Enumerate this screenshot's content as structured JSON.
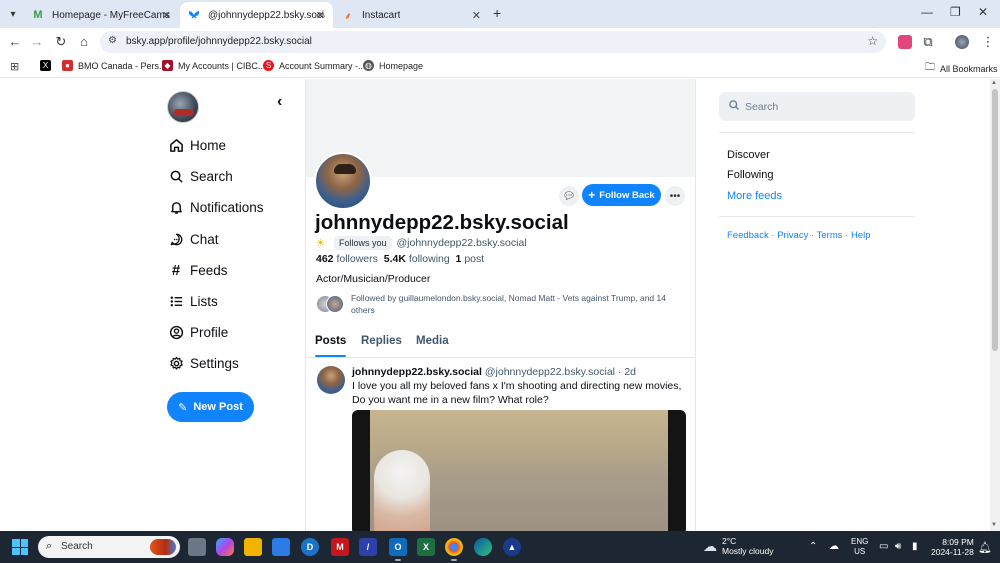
{
  "browser": {
    "tabs": [
      {
        "title": "Homepage - MyFreeCams",
        "favicon": "M",
        "favicon_color": "#2f9e44",
        "active": false
      },
      {
        "title": "@johnnydepp22.bsky.social —",
        "favicon": "butterfly",
        "favicon_color": "#1083fe",
        "active": true
      },
      {
        "title": "Instacart",
        "favicon": "carrot",
        "favicon_color": "#2f9e44",
        "active": false
      }
    ],
    "url": "bsky.app/profile/johnnydepp22.bsky.social",
    "bookmarks": [
      {
        "label": "",
        "icon": "x-icon",
        "color": "#000000"
      },
      {
        "label": "BMO Canada - Pers...",
        "icon": "bmo-icon",
        "color": "#d22e2e"
      },
      {
        "label": "My Accounts | CIBC...",
        "icon": "cibc-icon",
        "color": "#a3122a"
      },
      {
        "label": "Account Summary -...",
        "icon": "scotia-icon",
        "color": "#ec111a"
      },
      {
        "label": "Homepage",
        "icon": "globe-icon",
        "color": "#555555"
      }
    ],
    "all_bookmarks_label": "All Bookmarks"
  },
  "sidebar": {
    "items": [
      {
        "label": "Home",
        "icon": "home-icon"
      },
      {
        "label": "Search",
        "icon": "search-icon"
      },
      {
        "label": "Notifications",
        "icon": "bell-icon"
      },
      {
        "label": "Chat",
        "icon": "chat-icon"
      },
      {
        "label": "Feeds",
        "icon": "hash-icon"
      },
      {
        "label": "Lists",
        "icon": "list-icon"
      },
      {
        "label": "Profile",
        "icon": "profile-icon"
      },
      {
        "label": "Settings",
        "icon": "gear-icon"
      }
    ],
    "new_post_label": "New Post"
  },
  "profile": {
    "display_name": "johnnydepp22.bsky.social",
    "follows_you": "Follows you",
    "handle": "@johnnydepp22.bsky.social",
    "followers_count": "462",
    "followers_label": "followers",
    "following_count": "5.4K",
    "following_label": "following",
    "posts_count": "1",
    "posts_label": "post",
    "bio": "Actor/Musician/Producer",
    "followed_by": "Followed by guillaumelondon.bsky.social, Nomad Matt - Vets against Trump, and 14 others",
    "follow_back_label": "Follow Back",
    "tabs": [
      "Posts",
      "Replies",
      "Media"
    ]
  },
  "post": {
    "author_name": "johnnydepp22.bsky.social",
    "author_handle": "@johnnydepp22.bsky.social",
    "separator": "·",
    "time": "2d",
    "text": "I love you all my beloved fans x I'm shooting and directing new movies, Do you want me in a new film? What role?"
  },
  "right": {
    "search_placeholder": "Search",
    "feeds": [
      "Discover",
      "Following",
      "More feeds"
    ],
    "footer": [
      "Feedback",
      "Privacy",
      "Terms",
      "Help"
    ],
    "footer_sep": "·"
  },
  "taskbar": {
    "search_placeholder": "Search",
    "weather_temp": "2°C",
    "weather_desc": "Mostly cloudy",
    "lang_1": "ENG",
    "lang_2": "US",
    "time": "8:09 PM",
    "date": "2024-11-28"
  },
  "colors": {
    "accent": "#1083fe",
    "text": "#0b0f14",
    "muted": "#42576c"
  }
}
